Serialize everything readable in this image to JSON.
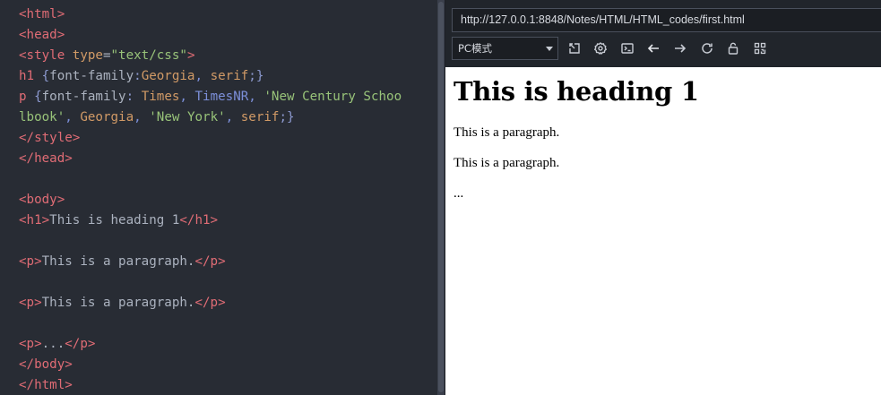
{
  "editor": {
    "lines": [
      [
        {
          "t": "tag",
          "v": "<html>"
        }
      ],
      [
        {
          "t": "tag",
          "v": "<head>"
        }
      ],
      [
        {
          "t": "tag",
          "v": "<style "
        },
        {
          "t": "attr",
          "v": "type"
        },
        {
          "t": "punct",
          "v": "="
        },
        {
          "t": "str",
          "v": "\"text/css\""
        },
        {
          "t": "tag",
          "v": ">"
        }
      ],
      [
        {
          "t": "tag",
          "v": "h1 "
        },
        {
          "t": "brace",
          "v": "{"
        },
        {
          "t": "prop",
          "v": "font-family"
        },
        {
          "t": "brace",
          "v": ":"
        },
        {
          "t": "val",
          "v": "Georgia"
        },
        {
          "t": "kw",
          "v": ", "
        },
        {
          "t": "val",
          "v": "serif"
        },
        {
          "t": "brace",
          "v": ";}"
        }
      ],
      [
        {
          "t": "tag",
          "v": "p "
        },
        {
          "t": "brace",
          "v": "{"
        },
        {
          "t": "prop",
          "v": "font-family"
        },
        {
          "t": "brace",
          "v": ": "
        },
        {
          "t": "val",
          "v": "Times"
        },
        {
          "t": "kw",
          "v": ", TimesNR, "
        },
        {
          "t": "str",
          "v": "'New Century Schoo"
        }
      ],
      [
        {
          "t": "str",
          "v": "lbook'"
        },
        {
          "t": "kw",
          "v": ", "
        },
        {
          "t": "val",
          "v": "Georgia"
        },
        {
          "t": "kw",
          "v": ", "
        },
        {
          "t": "str",
          "v": "'New York'"
        },
        {
          "t": "kw",
          "v": ", "
        },
        {
          "t": "val",
          "v": "serif"
        },
        {
          "t": "brace",
          "v": ";}"
        }
      ],
      [
        {
          "t": "tag",
          "v": "</style>"
        }
      ],
      [
        {
          "t": "tag",
          "v": "</head>"
        }
      ],
      [],
      [
        {
          "t": "tag",
          "v": "<body>"
        }
      ],
      [
        {
          "t": "tag",
          "v": "<h1>"
        },
        {
          "t": "text",
          "v": "This is heading 1"
        },
        {
          "t": "tag",
          "v": "</h1>"
        }
      ],
      [],
      [
        {
          "t": "tag",
          "v": "<p>"
        },
        {
          "t": "text",
          "v": "This is a paragraph."
        },
        {
          "t": "tag",
          "v": "</p>"
        }
      ],
      [],
      [
        {
          "t": "tag",
          "v": "<p>"
        },
        {
          "t": "text",
          "v": "This is a paragraph."
        },
        {
          "t": "tag",
          "v": "</p>"
        }
      ],
      [],
      [
        {
          "t": "tag",
          "v": "<p>"
        },
        {
          "t": "text",
          "v": "..."
        },
        {
          "t": "tag",
          "v": "</p>"
        }
      ],
      [
        {
          "t": "tag",
          "v": "</body>"
        }
      ],
      [
        {
          "t": "tag",
          "v": "</html>"
        }
      ]
    ]
  },
  "preview": {
    "url": "http://127.0.0.1:8848/Notes/HTML/HTML_codes/first.html",
    "mode": "PC模式",
    "toolbar_icons": [
      "screenshot-icon",
      "settings-icon",
      "console-icon",
      "back-arrow-icon",
      "forward-arrow-icon",
      "refresh-icon",
      "unlock-icon",
      "qrcode-icon"
    ],
    "page": {
      "heading": "This is heading 1",
      "paragraph1": "This is a paragraph.",
      "paragraph2": "This is a paragraph.",
      "paragraph3": "..."
    }
  },
  "colors": {
    "editor_bg": "#282c34",
    "tag": "#e06c75",
    "string": "#98c379",
    "attr_value": "#d19a66",
    "punct": "#7c8fd9"
  }
}
